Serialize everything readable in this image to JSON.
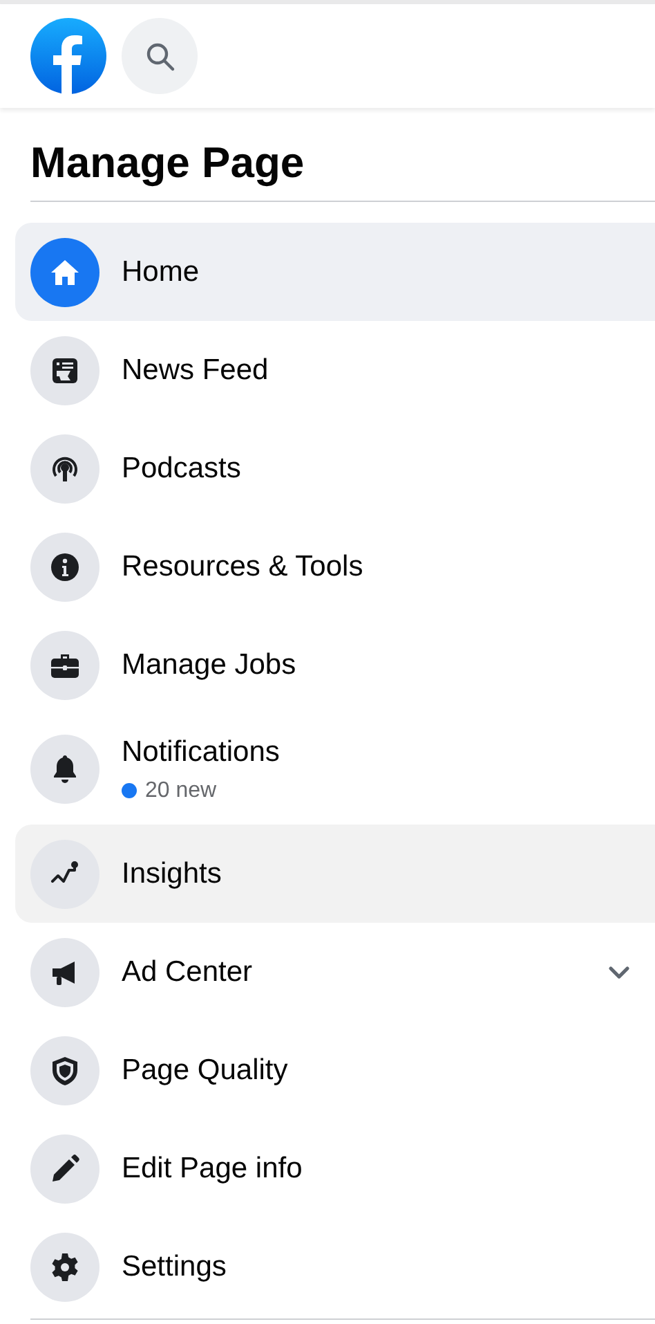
{
  "title": "Manage Page",
  "menu": [
    {
      "label": "Home",
      "selected": true,
      "hovered": false
    },
    {
      "label": "News Feed",
      "selected": false,
      "hovered": false
    },
    {
      "label": "Podcasts",
      "selected": false,
      "hovered": false
    },
    {
      "label": "Resources & Tools",
      "selected": false,
      "hovered": false
    },
    {
      "label": "Manage Jobs",
      "selected": false,
      "hovered": false
    },
    {
      "label": "Notifications",
      "selected": false,
      "hovered": false,
      "subtitle": "20 new",
      "unread": true
    },
    {
      "label": "Insights",
      "selected": false,
      "hovered": true
    },
    {
      "label": "Ad Center",
      "selected": false,
      "hovered": false,
      "expanded": false
    },
    {
      "label": "Page Quality",
      "selected": false,
      "hovered": false
    },
    {
      "label": "Edit Page info",
      "selected": false,
      "hovered": false
    },
    {
      "label": "Settings",
      "selected": false,
      "hovered": false
    }
  ]
}
